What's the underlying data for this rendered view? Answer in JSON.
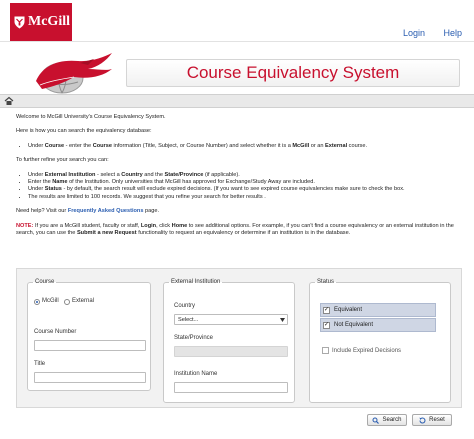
{
  "header": {
    "logo_text": "McGill",
    "login": "Login",
    "help": "Help"
  },
  "banner": {
    "title": "Course Equivalency System"
  },
  "nav": {
    "home_icon": "home-icon"
  },
  "content": {
    "welcome": "Welcome to McGill University's Course Equivalency System.",
    "howto": "Here is how you can search the equivalency database:",
    "bullet1": {
      "pre": "Under ",
      "course": "Course",
      "mid": " - enter the ",
      "course2": "Course",
      "mid2": " information (Title, Subject, or Course Number) and select whether it is a ",
      "mcgill": "McGill",
      "or": " or an ",
      "external": "External",
      "post": " course."
    },
    "refine": "To further refine your search you can:",
    "bullet2": {
      "pre": "Under ",
      "ext_inst": "External Institution",
      "mid": " - select a ",
      "country": "Country",
      "and": " and the ",
      "state": "State/Province",
      "post": " (if applicable)."
    },
    "bullet3": {
      "pre": "Enter the ",
      "name": "Name",
      "post": " of the Institution. Only universities that McGill has approved for Exchange/Study Away are included."
    },
    "bullet4": {
      "pre": "Under ",
      "status": "Status",
      "post": " - by default, the search result will exclude expired decisions. (If you want to see expired course equivalencies make sure to check the box."
    },
    "bullet5": "The results are limited to 100 records. We suggest that you refine your search for better results .",
    "help": {
      "pre": "Need help? Visit our ",
      "faq": "Frequently Asked Questions",
      "post": " page."
    },
    "note": {
      "label": "NOTE:",
      "t1": " If you are a McGill student, faculty or staff, ",
      "login": "Login",
      "t2": ", click ",
      "home": "Home",
      "t3": " to see additional options. For example, if you can't find a course equivalency or an external institution in the search, you can use the ",
      "submit": "Submit a new Request",
      "t4": " functionality to request an equivalency or determine if an institution is in the database."
    }
  },
  "form": {
    "course": {
      "legend": "Course",
      "mcgill": "McGill",
      "external": "External",
      "selected": "McGill",
      "course_number_label": "Course Number",
      "course_number_value": "",
      "title_label": "Title",
      "title_value": ""
    },
    "external": {
      "legend": "External Institution",
      "country_label": "Country",
      "country_value": "Select...",
      "state_label": "State/Province",
      "state_value": "",
      "inst_label": "Institution Name",
      "inst_value": ""
    },
    "status": {
      "legend": "Status",
      "equivalent": "Equivalent",
      "equivalent_checked": true,
      "not_equivalent": "Not Equivalent",
      "not_equivalent_checked": true,
      "include_expired": "Include Expired Decisions",
      "include_expired_checked": false
    },
    "buttons": {
      "search": "Search",
      "reset": "Reset"
    }
  },
  "colors": {
    "brand_red": "#c8102e",
    "link_blue": "#2a5db0"
  }
}
